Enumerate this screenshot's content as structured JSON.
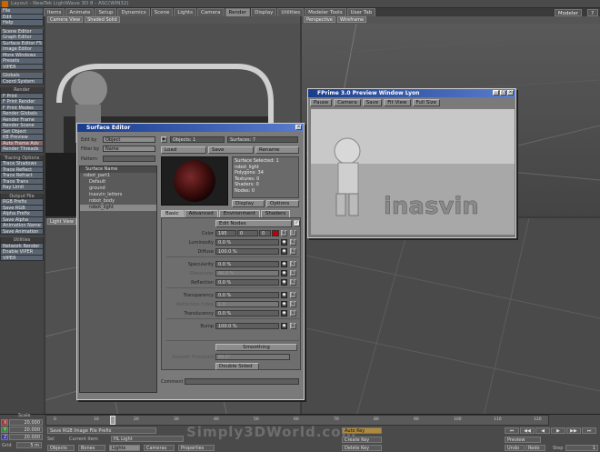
{
  "app": {
    "title": "Layout - NewTek LightWave 3D 8 - ASC(WIN32)",
    "modeler_label": "Modeler",
    "help_label": "? X"
  },
  "tabs": [
    "Items",
    "Animate",
    "Setup",
    "Dynamics",
    "Scene",
    "Lights",
    "Camera",
    "Render",
    "Display",
    "Utilities",
    "Modeler Tools",
    "User Tab"
  ],
  "active_tab": "Render",
  "sidebar": {
    "top": [
      "File",
      "Edit",
      "Help"
    ],
    "group1": [
      "Scene Editor",
      "Graph Editor",
      "Surface Editor  F5",
      "Image Editor",
      "More Windows",
      "Presets",
      "VIPER"
    ],
    "group2": [
      "Globals",
      "Coord System"
    ],
    "render_header": "Render",
    "render": [
      "F Print",
      "F Print Render",
      "F Print Modes",
      "Render Globals",
      "Render Frame",
      "Render Scene",
      "Set Object",
      "KB Preview",
      "Auto Frame Adv",
      "Render Threads"
    ],
    "tracing_header": "Tracing Options",
    "tracing": [
      "Trace Shadows",
      "Trace Reflect",
      "Trace Refract",
      "Trace Trans",
      "Ray Limit"
    ],
    "output_header": "Output File",
    "output": [
      "RGB Prefix",
      "Save RGB",
      "Alpha Prefix",
      "Save Alpha",
      "Animation Name",
      "Save Animation"
    ],
    "utilities_header": "Utilities",
    "utilities": [
      "Network Render",
      "Enable VIPER",
      "VIPER"
    ]
  },
  "viewports": {
    "vp1": {
      "view": "Camera View",
      "mode": "Shaded Solid"
    },
    "vp2": {
      "view": "Perspective",
      "mode": "Wireframe"
    },
    "vp3": {
      "view": "Light View"
    }
  },
  "surface_editor": {
    "title": "Surface Editor",
    "edit_by_label": "Edit by",
    "edit_by": "Object",
    "filter_by_label": "Filter by",
    "filter_by": "Name",
    "pattern_label": "Pattern",
    "objects_label": "Objects: 1",
    "surfaces_label": "Surfaces: 7",
    "load": "Load",
    "save": "Save",
    "rename": "Rename",
    "tree_header": "Surface Name",
    "tree": [
      "robot_part1",
      "Default",
      "ground",
      "inasvin_letters",
      "robot_body",
      "robot_light"
    ],
    "selected_tree": "robot_light",
    "info": [
      "Surface Selected: 1",
      "robot_light",
      "Polygons: 34",
      "Textures: 0",
      "Shaders: 0",
      "Nodes: 0"
    ],
    "display": "Display",
    "options": "Options",
    "subtabs": [
      "Basic",
      "Advanced",
      "Environment",
      "Shaders"
    ],
    "edit_nodes": "Edit Nodes",
    "color_label": "Color",
    "color_r": "195",
    "color_g": "0",
    "color_b": "0",
    "props": [
      {
        "label": "Luminosity",
        "value": "0.0 %"
      },
      {
        "label": "Diffuse",
        "value": "100.0 %"
      },
      {
        "label": "Specularity",
        "value": "0.0 %"
      },
      {
        "label": "Glossiness",
        "value": "40.0 %"
      },
      {
        "label": "Reflection",
        "value": "0.0 %"
      },
      {
        "label": "Transparency",
        "value": "0.0 %"
      },
      {
        "label": "Refraction Index",
        "value": "1.0"
      },
      {
        "label": "Translucency",
        "value": "0.0 %"
      },
      {
        "label": "Bump",
        "value": "100.0 %"
      }
    ],
    "smoothing": "Smoothing",
    "smooth_threshold_label": "Smooth Threshold",
    "smooth_threshold": "89.5°",
    "double_sided": "Double Sided",
    "comment_label": "Comment",
    "env_label": "E",
    "tex_label": "T"
  },
  "vipercrop": {
    "title": "FPrime 3.0 Preview Window Lyon",
    "buttons": [
      "Pause",
      "Camera",
      "Save",
      "Fit View",
      "Full Size"
    ],
    "render_text": "inasvin"
  },
  "bottom": {
    "x_label": "X",
    "y_label": "Y",
    "z_label": "Z",
    "x_val": "20.000",
    "y_val": "20.000",
    "z_val": "5 m",
    "grid_label": "Grid",
    "scale_label": "Scale",
    "file_prefix": "Save RGB Image File Prefix",
    "current_item_label": "Current Item",
    "current_item": "HL Light",
    "sel_label": "Sel",
    "objects": "Objects",
    "bones": "Bones",
    "lights": "Lights",
    "cameras": "Cameras",
    "properties": "Properties",
    "auto_key": "Auto Key",
    "create_key": "Create Key",
    "delete_key": "Delete Key",
    "preview": "Preview",
    "undo": "Undo",
    "redo": "Redo",
    "step_label": "Step",
    "step_val": "1",
    "timeline_ticks": [
      "0",
      "10",
      "20",
      "30",
      "40",
      "50",
      "60",
      "70",
      "80",
      "90",
      "100",
      "110",
      "120"
    ],
    "watermark": "Simply3DWorld.com"
  }
}
